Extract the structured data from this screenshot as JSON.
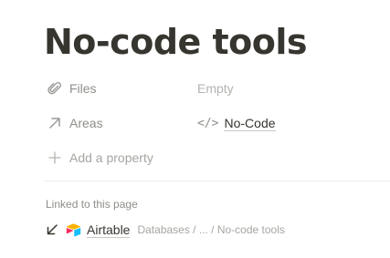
{
  "page": {
    "title": "No-code tools"
  },
  "properties": [
    {
      "name": "Files",
      "icon": "paperclip-icon",
      "value": "Empty"
    },
    {
      "name": "Areas",
      "icon": "arrow-up-right-icon",
      "value": "No-Code",
      "value_icon": "code-icon",
      "value_icon_glyph": "</>"
    }
  ],
  "add_property": {
    "label": "Add a property",
    "icon": "plus-icon"
  },
  "linked": {
    "heading": "Linked to this page",
    "items": [
      {
        "title": "Airtable",
        "path": "Databases / ... / No-code tools",
        "icon": "airtable-logo",
        "arrow_icon": "arrow-down-left-icon"
      }
    ]
  },
  "colors": {
    "text": "#37352f",
    "muted": "#8f8e8a",
    "placeholder": "#b4b3b0",
    "airtable_yellow": "#fcb400",
    "airtable_blue": "#18bfff",
    "airtable_red": "#f82b60"
  }
}
